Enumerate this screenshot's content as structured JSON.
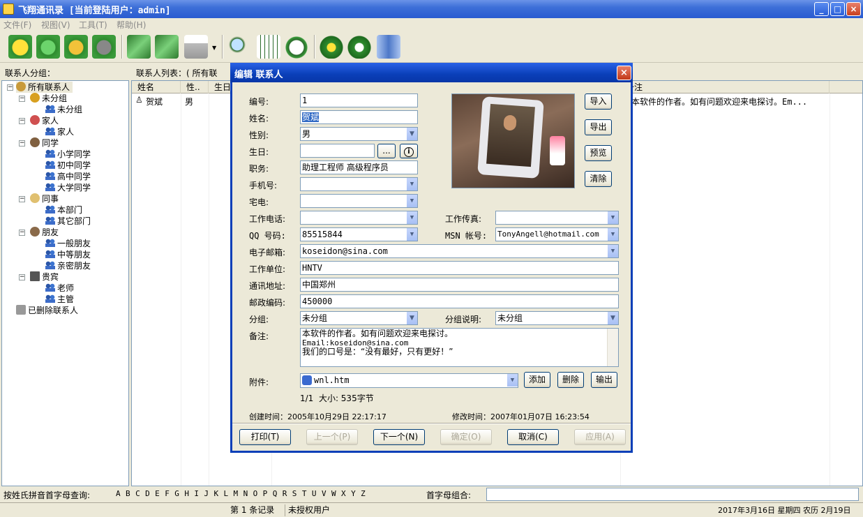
{
  "window": {
    "title": "飞翔通讯录 [当前登陆用户：admin]",
    "minimize": "_",
    "maximize": "□",
    "close": "×"
  },
  "menu": [
    "文件(F)",
    "视图(V)",
    "工具(T)",
    "帮助(H)"
  ],
  "toolbar_icons": [
    "smile-icon",
    "refresh-icon",
    "delete-icon",
    "gear-icon",
    "go-forward-icon",
    "go-next-icon",
    "print-icon",
    "search-icon",
    "calendar-icon",
    "clock-icon",
    "help-icon",
    "info-icon",
    "exit-icon"
  ],
  "left_panel": {
    "label": "联系人分组：",
    "tree": [
      {
        "label": "所有联系人",
        "level": 0
      },
      {
        "label": "未分组",
        "level": 1
      },
      {
        "label": "未分组",
        "level": 2
      },
      {
        "label": "家人",
        "level": 1
      },
      {
        "label": "家人",
        "level": 2
      },
      {
        "label": "同学",
        "level": 1
      },
      {
        "label": "小学同学",
        "level": 2
      },
      {
        "label": "初中同学",
        "level": 2
      },
      {
        "label": "高中同学",
        "level": 2
      },
      {
        "label": "大学同学",
        "level": 2
      },
      {
        "label": "同事",
        "level": 1
      },
      {
        "label": "本部门",
        "level": 2
      },
      {
        "label": "其它部门",
        "level": 2
      },
      {
        "label": "朋友",
        "level": 1
      },
      {
        "label": "一般朋友",
        "level": 2
      },
      {
        "label": "中等朋友",
        "level": 2
      },
      {
        "label": "亲密朋友",
        "level": 2
      },
      {
        "label": "贵宾",
        "level": 1
      },
      {
        "label": "老师",
        "level": 2
      },
      {
        "label": "主管",
        "level": 2
      },
      {
        "label": "已删除联系人",
        "level": 0
      }
    ]
  },
  "list": {
    "label": "联系人列表：( 所有联",
    "columns": [
      "姓名",
      "性..",
      "生日",
      "备注"
    ],
    "row": {
      "name": "贺斌",
      "gender": "男",
      "note": "本软件的作者。如有问题欢迎来电探讨。Em..."
    }
  },
  "dialog": {
    "title": "编辑 联系人",
    "close": "×",
    "fields": {
      "id_label": "编号:",
      "id": "1",
      "name_label": "姓名:",
      "name": "贺斌",
      "gender_label": "性别:",
      "gender": "男",
      "birthday_label": "生日:",
      "birthday": "",
      "birthday_btn": "...",
      "birthday_info": "i",
      "job_label": "职务:",
      "job": "助理工程师 高级程序员",
      "mobile_label": "手机号:",
      "mobile": "",
      "home_label": "宅电:",
      "home": "",
      "workphone_label": "工作电话:",
      "workphone": "",
      "fax_label": "工作传真:",
      "fax": "",
      "qq_label": "QQ 号码:",
      "qq": "85515844",
      "msn_label": "MSN 帐号:",
      "msn": "TonyAngell@hotmail.com",
      "email_label": "电子邮箱:",
      "email": "koseidon@sina.com",
      "company_label": "工作单位:",
      "company": "HNTV",
      "address_label": "通讯地址:",
      "address": "中国郑州",
      "zip_label": "邮政编码:",
      "zip": "450000",
      "group_label": "分组:",
      "group": "未分组",
      "group_desc_label": "分组说明:",
      "group_desc": "未分组",
      "note_label": "备注:",
      "note_lines": [
        "本软件的作者。如有问题欢迎来电探讨。",
        "Email:koseidon@sina.com",
        "我们的口号是：“没有最好，只有更好！”"
      ],
      "attach_label": "附件:",
      "attach": "wnl.htm",
      "attach_info": "1/1  大小: 535字节",
      "created": "创建时间：2005年10月29日 22:17:17",
      "modified": "修改时间：2007年01月07日 16:23:54"
    },
    "photo_buttons": [
      "导入",
      "导出",
      "预览",
      "清除"
    ],
    "attach_buttons": [
      "添加",
      "删除",
      "输出"
    ],
    "bottom_buttons": [
      {
        "label": "打印(T)",
        "enabled": true
      },
      {
        "label": "上一个(P)",
        "enabled": false
      },
      {
        "label": "下一个(N)",
        "enabled": true
      },
      {
        "label": "确定(O)",
        "enabled": false
      },
      {
        "label": "取消(C)",
        "enabled": true
      },
      {
        "label": "应用(A)",
        "enabled": false
      }
    ]
  },
  "alpha_bar": {
    "label": "按姓氏拼音首字母查询:",
    "letters": "A B C D E F G H I J K L M N O P Q R S T U V W X Y Z",
    "combo_label": "首字母组合:",
    "combo_value": ""
  },
  "status": {
    "records": "第 1 条记录",
    "license": "未授权用户",
    "date": "2017年3月16日 星期四 农历 2月19日"
  }
}
